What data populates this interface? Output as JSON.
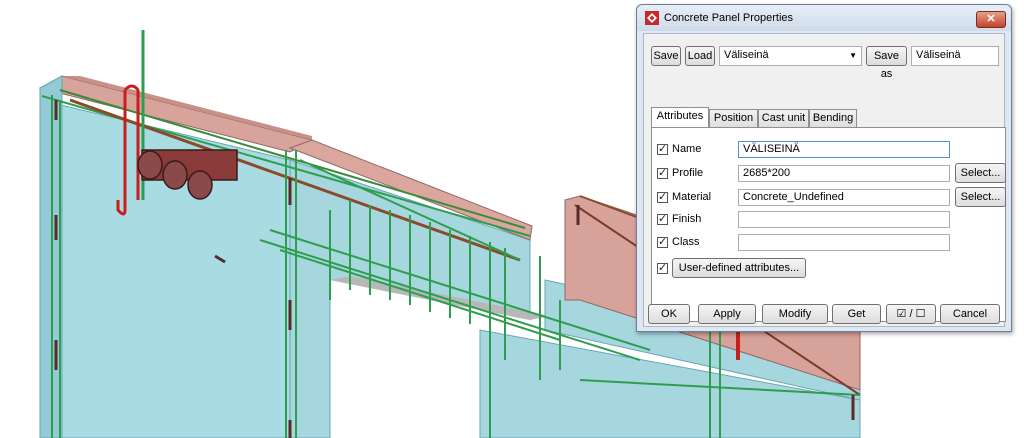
{
  "dialog": {
    "title": "Concrete Panel Properties",
    "close_label": "✕",
    "save_label": "Save",
    "load_label": "Load",
    "preset_value": "Väliseinä",
    "save_as_label": "Save as",
    "save_as_value": "Väliseinä",
    "tabs": [
      "Attributes",
      "Position",
      "Cast unit",
      "Bending"
    ],
    "fields": {
      "name": {
        "label": "Name",
        "value": "VÄLISEINÄ"
      },
      "profile": {
        "label": "Profile",
        "value": "2685*200",
        "select": "Select..."
      },
      "material": {
        "label": "Material",
        "value": "Concrete_Undefined",
        "select": "Select..."
      },
      "finish": {
        "label": "Finish",
        "value": ""
      },
      "class": {
        "label": "Class",
        "value": ""
      }
    },
    "uda_label": "User-defined attributes...",
    "footer": {
      "ok": "OK",
      "apply": "Apply",
      "modify": "Modify",
      "get": "Get",
      "toggle": "☑ / ☐",
      "cancel": "Cancel"
    }
  },
  "colors": {
    "wall_face": "#a6d8e0",
    "wall_top": "#d9a29a",
    "rebar_green": "#2e9e4e",
    "rebar_red": "#c81e1e",
    "rebar_brown": "#8b3a2a"
  }
}
